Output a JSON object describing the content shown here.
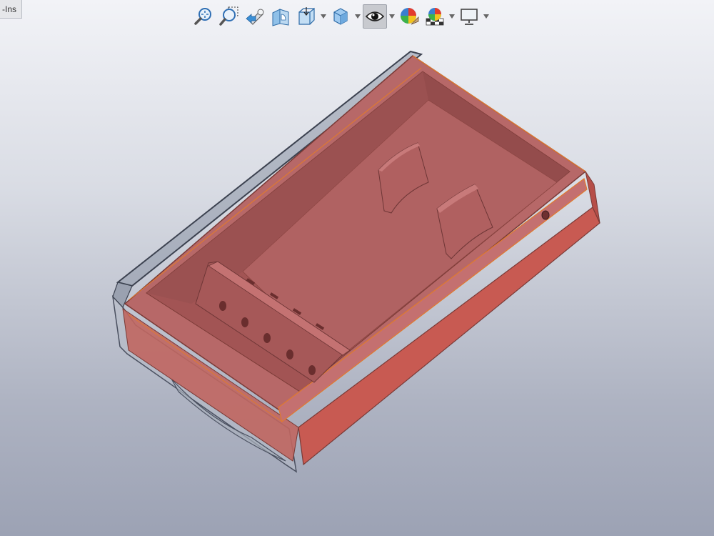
{
  "tab": {
    "label": "-Ins"
  },
  "toolbar": {
    "buttons": [
      "zoom-to-fit",
      "zoom-to-area",
      "previous-view",
      "section-view",
      "view-orientation",
      "display-style",
      "hide-show-items",
      "edit-appearance",
      "apply-scene",
      "view-settings"
    ],
    "active": "hide-show-items"
  },
  "colors": {
    "part_face": "#b76868",
    "part_dark": "#a25454",
    "part_side": "#c85a52",
    "edge": "#e07a2e",
    "shell": "#8d95a6",
    "shell_edge": "#3c4250"
  }
}
